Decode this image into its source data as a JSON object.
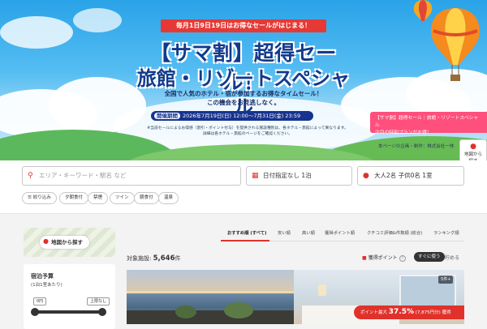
{
  "banner": {
    "top_pill": "毎月1日9日19日はお得なセールがはじまる！",
    "title_line1": "【サマ割】超得セール！",
    "title_line2": "旅館・リゾートスペシャル",
    "subtitle_line1": "全国で人気のホテル・宿が参加するお得なタイムセール！",
    "subtitle_line2": "この機会をお見逃しなく。",
    "period_tag": "開催期間",
    "period_text": "2026年7月19日(日) 12:00〜7月31日(金) 23:59",
    "note_line1": "※当該セールによるお得感（割引・ポイント付与）を提供される施設種別は、各ホテル・旅館によって異なります。",
    "note_line2": "詳細は各ホテル・旅館のページをご確認ください。",
    "credit": "本ページの企画・制作：株式会社一休"
  },
  "promo_card": {
    "line1": "【サマ割】超得セール｜旅館・リゾートスペシャル",
    "line2": "注目の特別プランがお得！"
  },
  "map_float": {
    "label_line1": "地図から",
    "label_line2": "探す"
  },
  "search": {
    "keyword_placeholder": "エリア・キーワード・駅名 など",
    "date_label": "日付指定なし 1泊",
    "guests_label": "大人2名  子供0名  1室"
  },
  "chips": [
    "絞り込み",
    "夕朝食付",
    "禁煙",
    "ツイン",
    "朝食付",
    "温泉"
  ],
  "sidebar": {
    "map_button": "地図から探す",
    "budget_title": "宿泊予算",
    "budget_sub": "(1泊1室あたり)",
    "min_label": "0円",
    "max_label": "上限なし"
  },
  "sort_tabs": [
    "おすすめ順 (すべて)",
    "安い順",
    "高い順",
    "獲得ポイント順",
    "クチコミ評価&件数順 (総合)",
    "ランキング順"
  ],
  "results": {
    "count_prefix": "対象施設:",
    "count_value": "5,646",
    "count_suffix": "件",
    "points_label": "獲得ポイント",
    "points_icon": "?",
    "toggle_on": "すぐに使う",
    "toggle_off": "貯める",
    "photo_count": "5件+",
    "badge_prefix": "ポイント最大",
    "badge_value": "37.5%",
    "badge_suffix": "(7,875円分) 獲得"
  },
  "colors": {
    "accent": "#e0312b",
    "banner_navy": "#123a8c",
    "promo_pink": "#ff4f7c"
  }
}
